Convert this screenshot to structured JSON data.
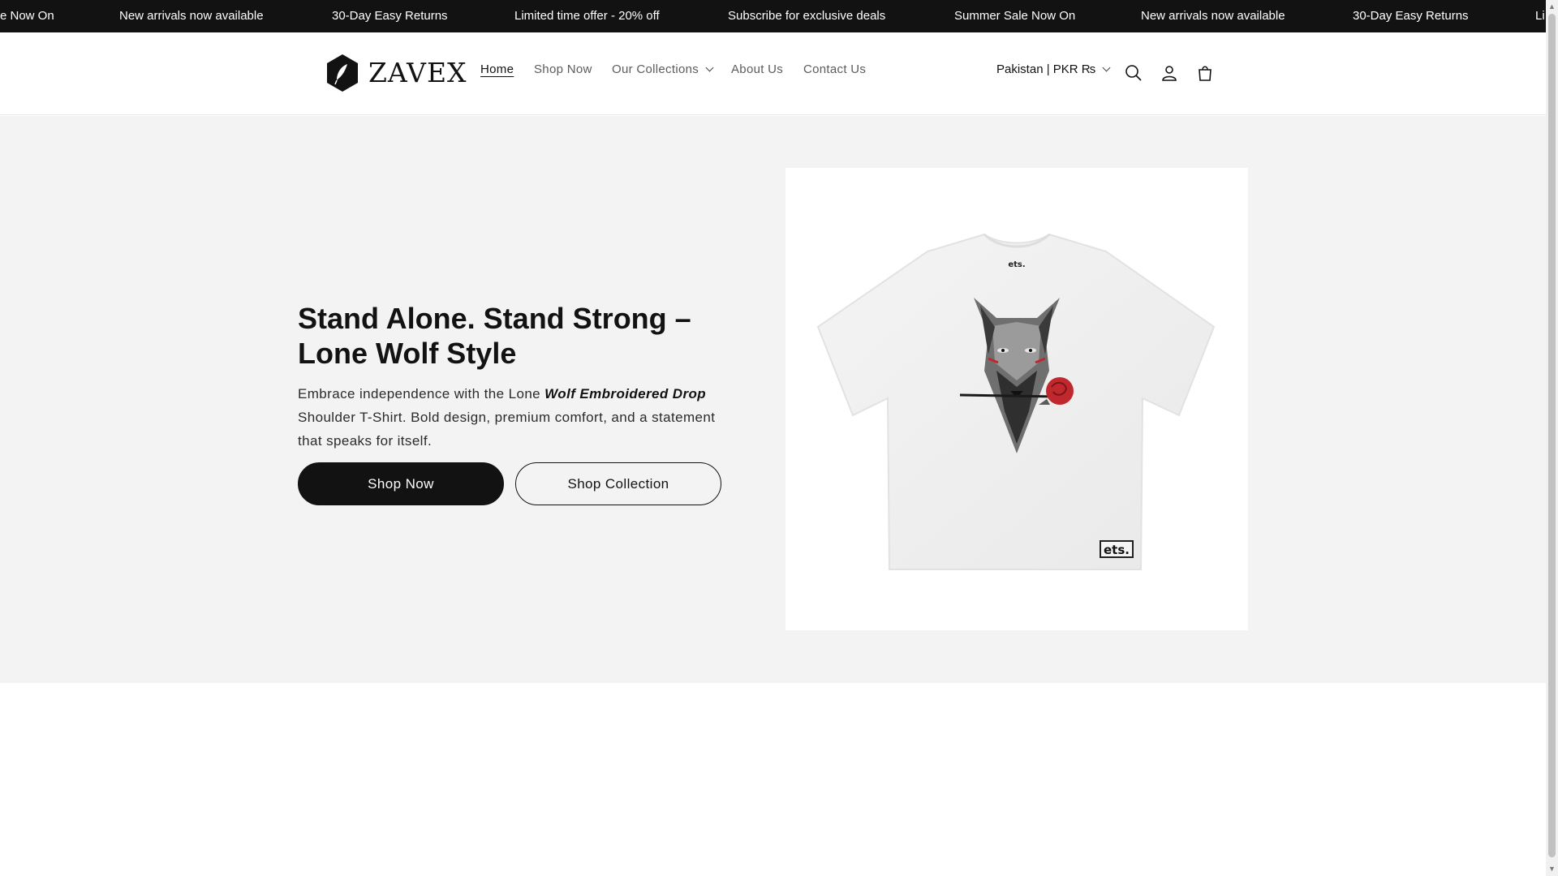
{
  "announcement": {
    "items": [
      "e Now On",
      "New arrivals now available",
      "30-Day Easy Returns",
      "Limited time offer - 20% off",
      "Subscribe for exclusive deals",
      "Summer Sale Now On",
      "New arrivals now available",
      "30-Day Easy Returns",
      "Li"
    ]
  },
  "header": {
    "logo_text": "ZAVEX",
    "nav": [
      "Home",
      "Shop Now",
      "Our Collections",
      "About Us",
      "Contact Us"
    ],
    "country": "Pakistan | PKR ₨",
    "icons": [
      "search-icon",
      "account-icon",
      "cart-icon"
    ]
  },
  "hero": {
    "title": "Stand Alone. Stand Strong – Lone Wolf Style",
    "text_before": "Embrace independence with the Lone ",
    "text_emphasis": "Wolf Embroidered Drop",
    "text_after": " Shoulder T-Shirt. Bold design, premium comfort, and a statement that speaks for itself.",
    "primary_button": "Shop Now",
    "secondary_button": "Shop Collection",
    "image_label": "ets."
  },
  "colors": {
    "announcement_bg": "#121212",
    "hero_bg": "#f3f3f3",
    "button_primary": "#121212",
    "accent_rose": "#c0282d"
  }
}
